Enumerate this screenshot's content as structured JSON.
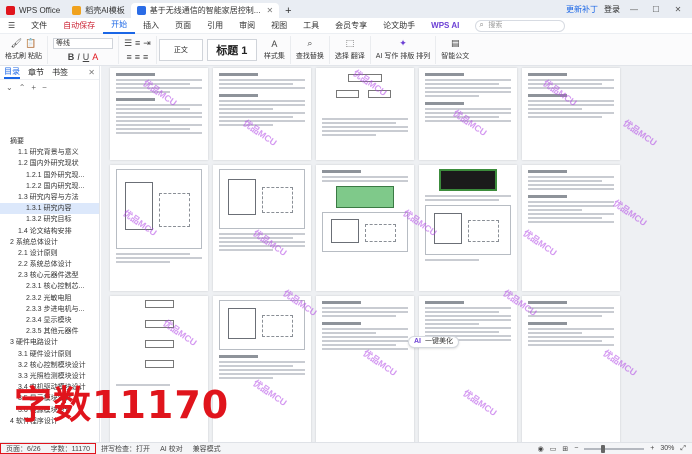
{
  "titlebar": {
    "tabs": [
      {
        "label": "WPS Office",
        "color": "#e0141c"
      },
      {
        "label": "稻壳AI模板",
        "color": "#f0a21e"
      },
      {
        "label": "基于无线通信的智能家居控制...",
        "color": "#2b6ce6"
      }
    ],
    "add_tab": "+",
    "update_label": "更新补丁",
    "user_label": "登录"
  },
  "menu": {
    "file": "文件",
    "autosave": "自动保存",
    "items": [
      "开始",
      "插入",
      "页面",
      "引用",
      "审阅",
      "视图",
      "工具",
      "会员专享",
      "论文助手"
    ],
    "active": "开始",
    "wps_ai": "WPS AI",
    "search_placeholder": "搜索"
  },
  "ribbon": {
    "format_painter": "格式刷",
    "paste": "粘贴",
    "font_name": "等线",
    "style_body": "正文",
    "style_h1": "标题 1",
    "style_set": "样式集",
    "find_replace": "查找替换",
    "translate": "翻译",
    "select": "选择",
    "ai_write": "AI 写作",
    "typeset": "排版",
    "layout": "排列",
    "smart_doc": "智能公文"
  },
  "nav": {
    "tabs": [
      "目录",
      "章节",
      "书签"
    ],
    "active": "目录",
    "items": [
      {
        "label": "摘要",
        "level": 1
      },
      {
        "label": "1.1 研究背景与意义",
        "level": 2
      },
      {
        "label": "1.2 国内外研究现状",
        "level": 2
      },
      {
        "label": "1.2.1 国外研究现...",
        "level": 3
      },
      {
        "label": "1.2.2 国内研究现...",
        "level": 3
      },
      {
        "label": "1.3 研究内容与方法",
        "level": 2
      },
      {
        "label": "1.3.1 研究内容",
        "level": 3,
        "selected": true
      },
      {
        "label": "1.3.2 研究目标",
        "level": 3
      },
      {
        "label": "1.4 论文结构安排",
        "level": 2
      },
      {
        "label": "2 系统总体设计",
        "level": 1
      },
      {
        "label": "2.1 设计原则",
        "level": 2
      },
      {
        "label": "2.2 系统总体设计",
        "level": 2
      },
      {
        "label": "2.3 核心元器件选型",
        "level": 2
      },
      {
        "label": "2.3.1 核心控制芯...",
        "level": 3
      },
      {
        "label": "2.3.2 光敏电阻",
        "level": 3
      },
      {
        "label": "2.3.3 步进电机与...",
        "level": 3
      },
      {
        "label": "2.3.4 显示模块",
        "level": 3
      },
      {
        "label": "2.3.5 其他元器件",
        "level": 3
      },
      {
        "label": "3 硬件电路设计",
        "level": 1
      },
      {
        "label": "3.1 硬件设计原则",
        "level": 2
      },
      {
        "label": "3.2 核心控制模块设计",
        "level": 2
      },
      {
        "label": "3.3 光照检测模块设计",
        "level": 2
      },
      {
        "label": "3.4 电机驱动模块设计",
        "level": 2
      },
      {
        "label": "3.5 显示模块设计",
        "level": 2
      },
      {
        "label": "3.6 电源模块设计",
        "level": 2
      },
      {
        "label": "4 软件程序设计",
        "level": 1
      }
    ]
  },
  "document": {
    "watermark": "优品MCU",
    "ai_bubble_icon": "AI",
    "ai_bubble_label": "一键美化"
  },
  "overlay": {
    "word_count_caption": "字数11170",
    "caption_color": "#e0141c"
  },
  "statusbar": {
    "page": "页面：6/26",
    "words": "字数：11170",
    "spellcheck": "拼写检查：打开",
    "ai_proof": "AI 校对",
    "compat_mode": "兼容模式",
    "zoom": "30%",
    "zoom_fraction": 0.3
  }
}
